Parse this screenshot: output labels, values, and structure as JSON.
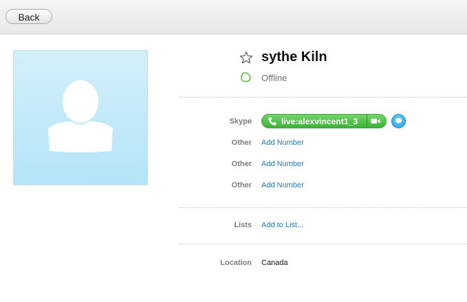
{
  "toolbar": {
    "back_label": "Back"
  },
  "contact": {
    "name": "sythe Kiln",
    "status": "Offline"
  },
  "skype": {
    "label": "Skype",
    "id": "live:alexvincent1_3"
  },
  "phones": [
    {
      "label": "Other",
      "action": "Add Number"
    },
    {
      "label": "Other",
      "action": "Add Number"
    },
    {
      "label": "Other",
      "action": "Add Number"
    }
  ],
  "lists": {
    "label": "Lists",
    "action": "Add to List..."
  },
  "location": {
    "label": "Location",
    "value": "Canada"
  },
  "icons": {
    "star": "star-outline-icon",
    "status": "offline-status-icon",
    "call": "phone-icon",
    "video": "video-camera-icon",
    "chat": "chat-bubble-icon",
    "avatar": "default-avatar-silhouette"
  },
  "colors": {
    "accent_green": "#3eb236",
    "link_blue": "#2277bb",
    "chat_blue": "#1d9de0",
    "avatar_bg": "#c6ebf9"
  }
}
